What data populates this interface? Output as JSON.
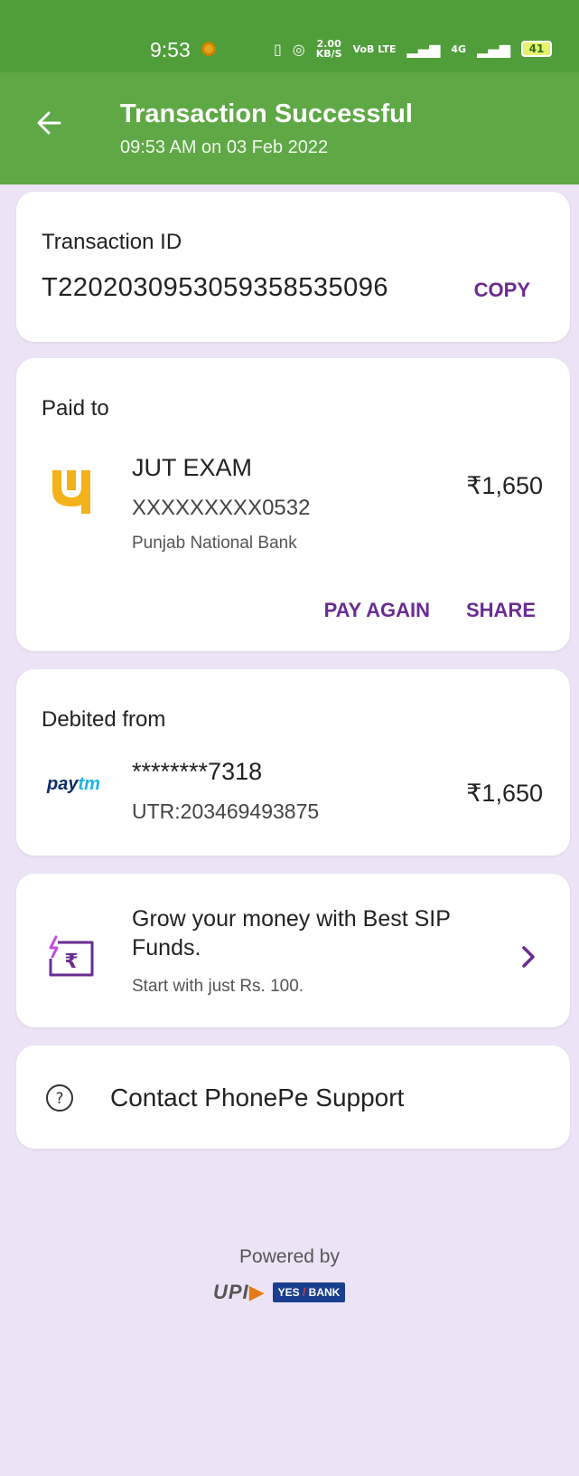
{
  "status_bar": {
    "time": "9:53",
    "speed_value": "2.00",
    "speed_unit": "KB/S",
    "volte": "VoB LTE",
    "network": "4G",
    "battery": "41"
  },
  "header": {
    "title": "Transaction Successful",
    "subtitle": "09:53 AM on 03 Feb 2022"
  },
  "transaction": {
    "label": "Transaction ID",
    "id": "T2202030953059358535096",
    "copy_label": "COPY"
  },
  "paid_to": {
    "label": "Paid to",
    "name": "JUT EXAM",
    "account": "XXXXXXXXX0532",
    "bank": "Punjab National Bank",
    "amount": "₹1,650",
    "pay_again_label": "PAY AGAIN",
    "share_label": "SHARE"
  },
  "debited_from": {
    "label": "Debited from",
    "logo_pay": "pay",
    "logo_tm": "tm",
    "account": "********7318",
    "utr": "UTR:203469493875",
    "amount": "₹1,650"
  },
  "sip": {
    "title": "Grow your money with Best SIP Funds.",
    "subtitle": "Start with just Rs. 100."
  },
  "support": {
    "label": "Contact PhonePe Support"
  },
  "footer": {
    "powered_by": "Powered by",
    "upi": "UPI",
    "yes": "YES",
    "bank": "BANK"
  },
  "colors": {
    "status_bar": "#4f9e3a",
    "header": "#5fa846",
    "background": "#ece4f6",
    "accent": "#6a2c91"
  }
}
